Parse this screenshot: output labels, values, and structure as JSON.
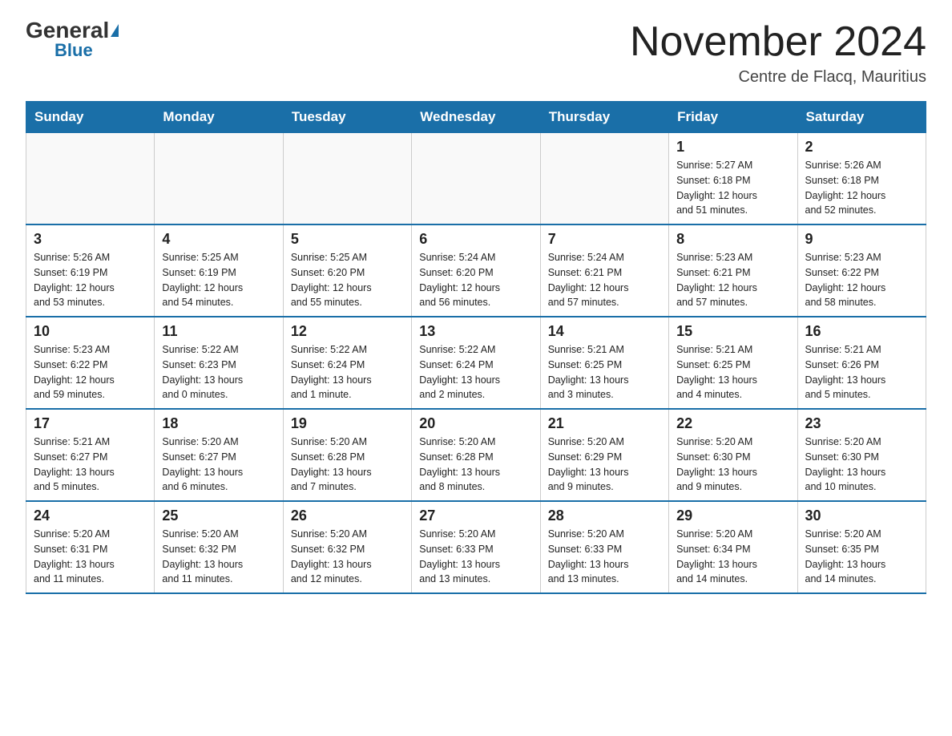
{
  "header": {
    "logo_general": "General",
    "logo_blue": "Blue",
    "title": "November 2024",
    "subtitle": "Centre de Flacq, Mauritius"
  },
  "days_of_week": [
    "Sunday",
    "Monday",
    "Tuesday",
    "Wednesday",
    "Thursday",
    "Friday",
    "Saturday"
  ],
  "weeks": [
    [
      {
        "day": "",
        "info": ""
      },
      {
        "day": "",
        "info": ""
      },
      {
        "day": "",
        "info": ""
      },
      {
        "day": "",
        "info": ""
      },
      {
        "day": "",
        "info": ""
      },
      {
        "day": "1",
        "info": "Sunrise: 5:27 AM\nSunset: 6:18 PM\nDaylight: 12 hours\nand 51 minutes."
      },
      {
        "day": "2",
        "info": "Sunrise: 5:26 AM\nSunset: 6:18 PM\nDaylight: 12 hours\nand 52 minutes."
      }
    ],
    [
      {
        "day": "3",
        "info": "Sunrise: 5:26 AM\nSunset: 6:19 PM\nDaylight: 12 hours\nand 53 minutes."
      },
      {
        "day": "4",
        "info": "Sunrise: 5:25 AM\nSunset: 6:19 PM\nDaylight: 12 hours\nand 54 minutes."
      },
      {
        "day": "5",
        "info": "Sunrise: 5:25 AM\nSunset: 6:20 PM\nDaylight: 12 hours\nand 55 minutes."
      },
      {
        "day": "6",
        "info": "Sunrise: 5:24 AM\nSunset: 6:20 PM\nDaylight: 12 hours\nand 56 minutes."
      },
      {
        "day": "7",
        "info": "Sunrise: 5:24 AM\nSunset: 6:21 PM\nDaylight: 12 hours\nand 57 minutes."
      },
      {
        "day": "8",
        "info": "Sunrise: 5:23 AM\nSunset: 6:21 PM\nDaylight: 12 hours\nand 57 minutes."
      },
      {
        "day": "9",
        "info": "Sunrise: 5:23 AM\nSunset: 6:22 PM\nDaylight: 12 hours\nand 58 minutes."
      }
    ],
    [
      {
        "day": "10",
        "info": "Sunrise: 5:23 AM\nSunset: 6:22 PM\nDaylight: 12 hours\nand 59 minutes."
      },
      {
        "day": "11",
        "info": "Sunrise: 5:22 AM\nSunset: 6:23 PM\nDaylight: 13 hours\nand 0 minutes."
      },
      {
        "day": "12",
        "info": "Sunrise: 5:22 AM\nSunset: 6:24 PM\nDaylight: 13 hours\nand 1 minute."
      },
      {
        "day": "13",
        "info": "Sunrise: 5:22 AM\nSunset: 6:24 PM\nDaylight: 13 hours\nand 2 minutes."
      },
      {
        "day": "14",
        "info": "Sunrise: 5:21 AM\nSunset: 6:25 PM\nDaylight: 13 hours\nand 3 minutes."
      },
      {
        "day": "15",
        "info": "Sunrise: 5:21 AM\nSunset: 6:25 PM\nDaylight: 13 hours\nand 4 minutes."
      },
      {
        "day": "16",
        "info": "Sunrise: 5:21 AM\nSunset: 6:26 PM\nDaylight: 13 hours\nand 5 minutes."
      }
    ],
    [
      {
        "day": "17",
        "info": "Sunrise: 5:21 AM\nSunset: 6:27 PM\nDaylight: 13 hours\nand 5 minutes."
      },
      {
        "day": "18",
        "info": "Sunrise: 5:20 AM\nSunset: 6:27 PM\nDaylight: 13 hours\nand 6 minutes."
      },
      {
        "day": "19",
        "info": "Sunrise: 5:20 AM\nSunset: 6:28 PM\nDaylight: 13 hours\nand 7 minutes."
      },
      {
        "day": "20",
        "info": "Sunrise: 5:20 AM\nSunset: 6:28 PM\nDaylight: 13 hours\nand 8 minutes."
      },
      {
        "day": "21",
        "info": "Sunrise: 5:20 AM\nSunset: 6:29 PM\nDaylight: 13 hours\nand 9 minutes."
      },
      {
        "day": "22",
        "info": "Sunrise: 5:20 AM\nSunset: 6:30 PM\nDaylight: 13 hours\nand 9 minutes."
      },
      {
        "day": "23",
        "info": "Sunrise: 5:20 AM\nSunset: 6:30 PM\nDaylight: 13 hours\nand 10 minutes."
      }
    ],
    [
      {
        "day": "24",
        "info": "Sunrise: 5:20 AM\nSunset: 6:31 PM\nDaylight: 13 hours\nand 11 minutes."
      },
      {
        "day": "25",
        "info": "Sunrise: 5:20 AM\nSunset: 6:32 PM\nDaylight: 13 hours\nand 11 minutes."
      },
      {
        "day": "26",
        "info": "Sunrise: 5:20 AM\nSunset: 6:32 PM\nDaylight: 13 hours\nand 12 minutes."
      },
      {
        "day": "27",
        "info": "Sunrise: 5:20 AM\nSunset: 6:33 PM\nDaylight: 13 hours\nand 13 minutes."
      },
      {
        "day": "28",
        "info": "Sunrise: 5:20 AM\nSunset: 6:33 PM\nDaylight: 13 hours\nand 13 minutes."
      },
      {
        "day": "29",
        "info": "Sunrise: 5:20 AM\nSunset: 6:34 PM\nDaylight: 13 hours\nand 14 minutes."
      },
      {
        "day": "30",
        "info": "Sunrise: 5:20 AM\nSunset: 6:35 PM\nDaylight: 13 hours\nand 14 minutes."
      }
    ]
  ]
}
